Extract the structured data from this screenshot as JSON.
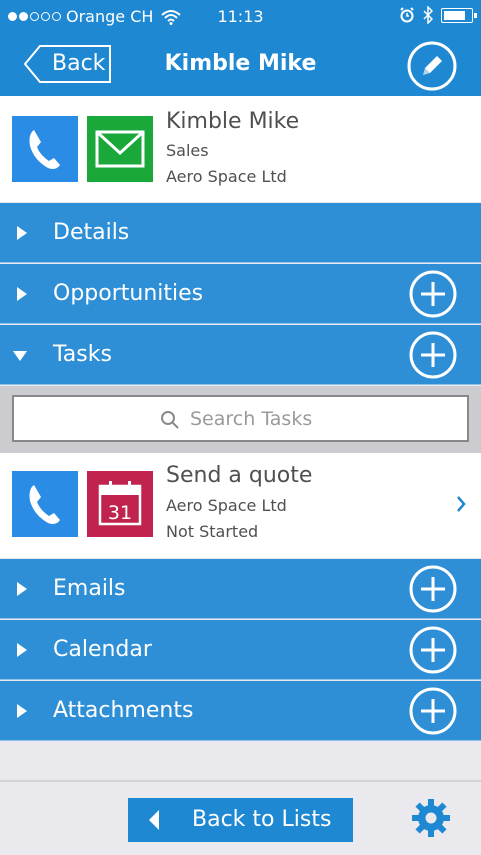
{
  "status_bar": {
    "carrier": "Orange CH",
    "time": "11:13",
    "battery_level": 0.85
  },
  "nav": {
    "back_label": "Back",
    "title": "Kimble Mike"
  },
  "contact": {
    "name": "Kimble Mike",
    "department": "Sales",
    "company": "Aero Space Ltd"
  },
  "sections": {
    "details": "Details",
    "opportunities": "Opportunities",
    "tasks": "Tasks",
    "emails": "Emails",
    "calendar": "Calendar",
    "attachments": "Attachments"
  },
  "search": {
    "placeholder": "Search Tasks"
  },
  "task": {
    "title": "Send a quote",
    "company": "Aero Space Ltd",
    "status": "Not Started",
    "calendar_day": "31"
  },
  "footer": {
    "back_to_lists": "Back to Lists"
  },
  "colors": {
    "primary": "#1e88d2",
    "section": "#2f8fd6",
    "phone_tile": "#2b8ce6",
    "email_tile": "#1aa83b",
    "calendar_tile": "#c0244e"
  },
  "icons": [
    "wifi-icon",
    "alarm-icon",
    "bluetooth-icon",
    "battery-icon",
    "back-arrow-icon",
    "edit-pencil-icon",
    "phone-icon",
    "email-icon",
    "triangle-right-icon",
    "triangle-down-icon",
    "plus-circle-icon",
    "search-icon",
    "calendar-icon",
    "chevron-right-icon",
    "gear-icon"
  ]
}
